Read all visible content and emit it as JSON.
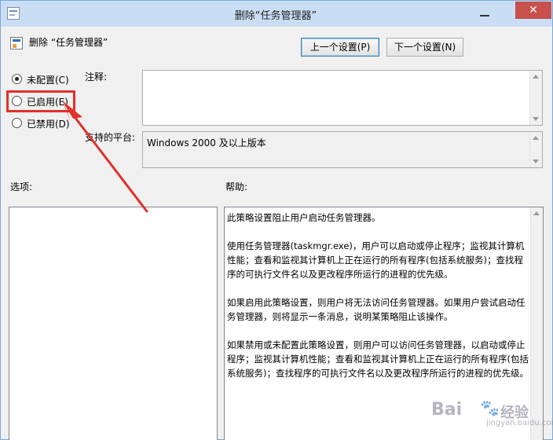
{
  "window": {
    "title": "删除“任务管理器”",
    "close_glyph": "✕"
  },
  "policy": {
    "name": "删除 “任务管理器”"
  },
  "toolbar": {
    "prev_label": "上一个设置(P)",
    "next_label": "下一个设置(N)"
  },
  "state": {
    "options": [
      {
        "label": "未配置(C)",
        "checked": true
      },
      {
        "label": "已启用(E)",
        "checked": false
      },
      {
        "label": "已禁用(D)",
        "checked": false
      }
    ]
  },
  "fields": {
    "comment_label": "注释:",
    "platform_label": "支持的平台:",
    "platform_value": "Windows 2000 及以上版本",
    "options_label": "选项:",
    "help_label": "帮助:"
  },
  "help": {
    "paragraphs": [
      "此策略设置阻止用户启动任务管理器。",
      "使用任务管理器(taskmgr.exe)，用户可以启动或停止程序；监视其计算机性能；查看和监视其计算机上正在运行的所有程序(包括系统服务)；查找程序的可执行文件名以及更改程序所运行的进程的优先级。",
      "如果启用此策略设置，则用户将无法访问任务管理器。如果用户尝试启动任务管理器，则将显示一条消息，说明某策略阻止该操作。",
      "如果禁用或未配置此策略设置，则用户可以访问任务管理器，以启动或停止程序；监视其计算机性能；查看和监视其计算机上正在运行的所有程序(包括系统服务)；查找程序的可执行文件名以及更改程序所运行的进程的优先级。"
    ]
  },
  "watermark": {
    "brand": "Bai",
    "paw": "🐾",
    "cn": "经验",
    "sub": "jingyan.baidu.com"
  },
  "colors": {
    "highlight": "#e0312c",
    "close_button": "#c7514c",
    "titlebar": "#c9def5"
  },
  "icons": [
    "app-icon",
    "policy-icon",
    "close-icon",
    "minimize-icon",
    "arrow-annotation"
  ]
}
